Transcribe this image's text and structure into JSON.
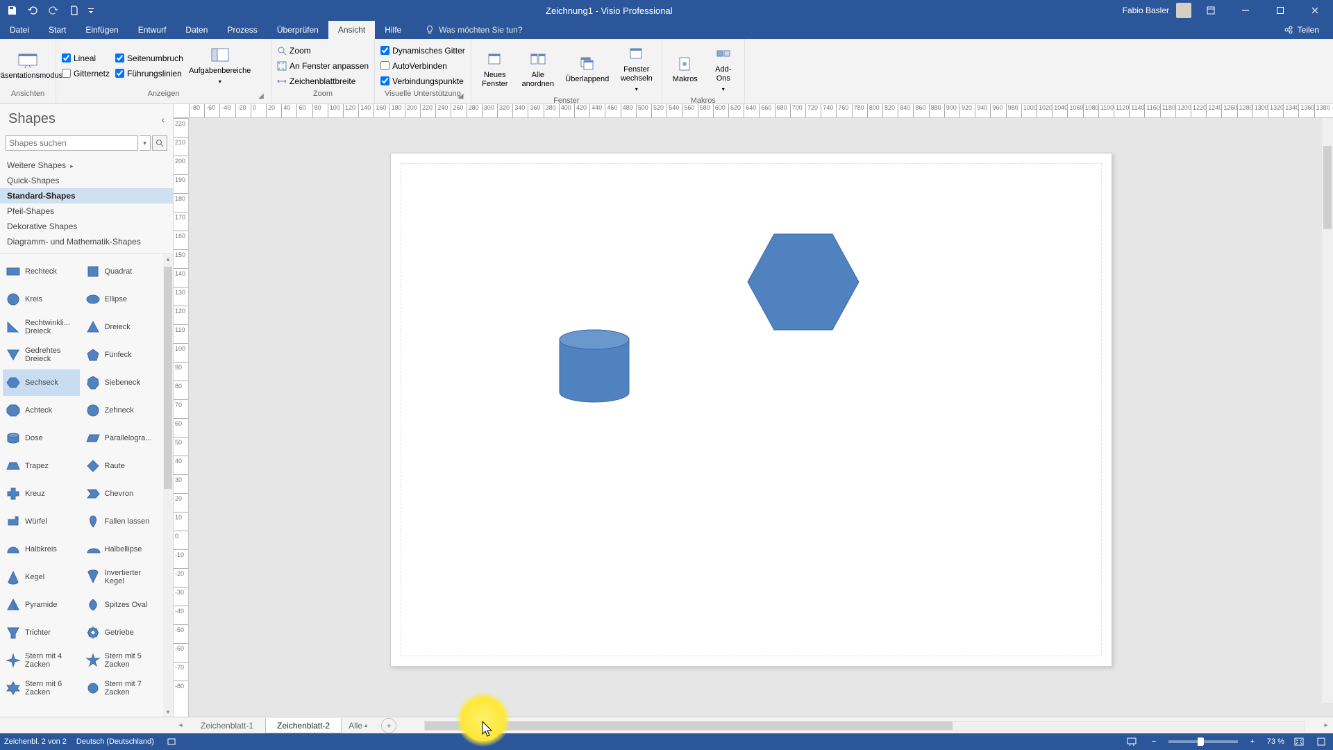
{
  "titlebar": {
    "doc_title": "Zeichnung1",
    "app_name": "Visio Professional",
    "user": "Fabio Basler"
  },
  "menu": {
    "tabs": [
      "Datei",
      "Start",
      "Einfügen",
      "Entwurf",
      "Daten",
      "Prozess",
      "Überprüfen",
      "Ansicht",
      "Hilfe"
    ],
    "active_index": 7,
    "tell_me": "Was möchten Sie tun?",
    "share": "Teilen"
  },
  "ribbon": {
    "g0": {
      "btn": "Präsentationsmodus",
      "label": "Ansichten"
    },
    "g1": {
      "lineal": "Lineal",
      "seitenumbruch": "Seitenumbruch",
      "gitternetz": "Gitternetz",
      "fuehrungslinien": "Führungslinien",
      "aufgaben": "Aufgabenbereiche",
      "label": "Anzeigen"
    },
    "g2": {
      "zoom": "Zoom",
      "fenster_anpassen": "An Fenster anpassen",
      "blattbreite": "Zeichenblattbreite",
      "label": "Zoom"
    },
    "g3": {
      "dyn_gitter": "Dynamisches Gitter",
      "autoverbinden": "AutoVerbinden",
      "verbindungspunkte": "Verbindungspunkte",
      "label": "Visuelle Unterstützung"
    },
    "g4": {
      "neues_fenster": "Neues Fenster",
      "alle_anordnen": "Alle anordnen",
      "ueberlappend": "Überlappend",
      "fenster_wechseln": "Fenster wechseln",
      "label": "Fenster"
    },
    "g5": {
      "makros": "Makros",
      "addons": "Add-Ons",
      "label": "Makros"
    }
  },
  "shapes_panel": {
    "title": "Shapes",
    "search_placeholder": "Shapes suchen",
    "stencils": [
      {
        "label": "Weitere Shapes",
        "has_sub": true
      },
      {
        "label": "Quick-Shapes"
      },
      {
        "label": "Standard-Shapes",
        "selected": true
      },
      {
        "label": "Pfeil-Shapes"
      },
      {
        "label": "Dekorative Shapes"
      },
      {
        "label": "Diagramm- und Mathematik-Shapes"
      }
    ],
    "shapes": [
      "Rechteck",
      "Quadrat",
      "Kreis",
      "Ellipse",
      "Rechtwinkli... Dreieck",
      "Dreieck",
      "Gedrehtes Dreieck",
      "Fünfeck",
      "Sechseck",
      "Siebeneck",
      "Achteck",
      "Zehneck",
      "Dose",
      "Parallelogra...",
      "Trapez",
      "Raute",
      "Kreuz",
      "Chevron",
      "Würfel",
      "Fallen lassen",
      "Halbkreis",
      "Halbellipse",
      "Kegel",
      "Invertierter Kegel",
      "Pyramide",
      "Spitzes Oval",
      "Trichter",
      "Getriebe",
      "Stern mit 4 Zacken",
      "Stern mit 5 Zacken",
      "Stern mit 6 Zacken",
      "Stern mit 7 Zacken"
    ],
    "selected_shape_index": 8
  },
  "page_tabs": {
    "tabs": [
      "Zeichenblatt-1",
      "Zeichenblatt-2"
    ],
    "active_index": 1,
    "all": "Alle"
  },
  "statusbar": {
    "sheet_info": "Zeichenbl. 2 von 2",
    "language": "Deutsch (Deutschland)",
    "zoom": "73 %"
  },
  "ruler_h": [
    -80,
    -60,
    -40,
    -20,
    0,
    20,
    40,
    60,
    80,
    100,
    120,
    140,
    160,
    180,
    200,
    220,
    240,
    260,
    280,
    300,
    320,
    340,
    360,
    380,
    400,
    420,
    440,
    460,
    480,
    500,
    520,
    540,
    560,
    580,
    600,
    620,
    640,
    660,
    680,
    700,
    720,
    740,
    760,
    780,
    800,
    820,
    840,
    860,
    880,
    900,
    920,
    940,
    960,
    980,
    1000,
    1020,
    1040,
    1060,
    1080,
    1100,
    1120,
    1140,
    1160,
    1180,
    1200,
    1220,
    1240,
    1260,
    1280,
    1300,
    1320,
    1340,
    1360,
    1380
  ],
  "ruler_v": [
    220,
    210,
    200,
    190,
    180,
    170,
    160,
    150,
    140,
    130,
    120,
    110,
    100,
    90,
    80,
    70,
    60,
    50,
    40,
    30,
    20,
    10,
    0,
    -10,
    -20,
    -30,
    -40,
    -50,
    -60,
    -70,
    -80
  ],
  "colors": {
    "shape_fill": "#5082c0",
    "shape_fill_dark": "#3f6ba5",
    "accent": "#2b579a"
  }
}
